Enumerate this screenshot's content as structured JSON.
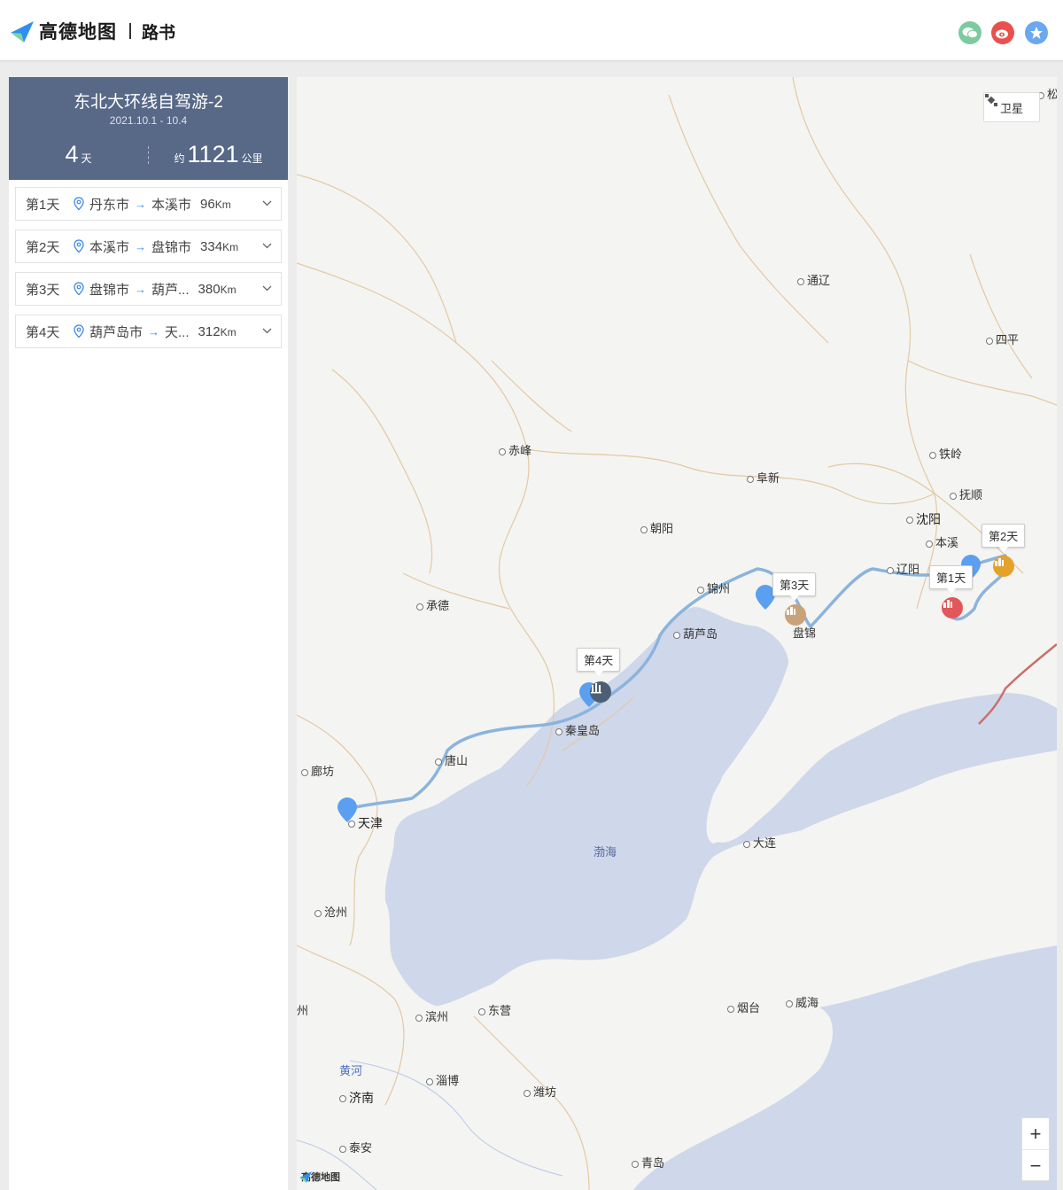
{
  "header": {
    "brand": "高德地图",
    "module": "路书",
    "share": {
      "wechat_icon": "wechat-icon",
      "weibo_icon": "weibo-icon",
      "favorite_icon": "star-icon"
    }
  },
  "trip": {
    "title": "东北大环线自驾游-2",
    "date": "2021.10.1 - 10.4",
    "days_value": "4",
    "days_unit": "天",
    "distance_prefix": "约",
    "distance_value": "1121",
    "distance_unit": "公里"
  },
  "days": [
    {
      "label": "第1天",
      "from": "丹东市",
      "to": "本溪市",
      "distance": "96",
      "unit": "Km"
    },
    {
      "label": "第2天",
      "from": "本溪市",
      "to": "盘锦市",
      "distance": "334",
      "unit": "Km"
    },
    {
      "label": "第3天",
      "from": "盘锦市",
      "to": "葫芦...",
      "distance": "380",
      "unit": "Km"
    },
    {
      "label": "第4天",
      "from": "葫芦岛市",
      "to": "天...",
      "distance": "312",
      "unit": "Km"
    }
  ],
  "map": {
    "satellite_label": "卫星",
    "zoom_in": "+",
    "zoom_out": "−",
    "logo_text": "高德地图",
    "callouts": {
      "day1": "第1天",
      "day2": "第2天",
      "day3": "第3天",
      "day4": "第4天"
    },
    "cities": {
      "songyuan": "松原",
      "tongliao": "通辽",
      "siping": "四平",
      "chifeng": "赤峰",
      "fuxin": "阜新",
      "tieling": "铁岭",
      "fushun": "抚顺",
      "shenyang": "沈阳",
      "benxi": "本溪",
      "chaoyang": "朝阳",
      "liaoyang": "辽阳",
      "jinzhou": "锦州",
      "chengde": "承德",
      "huludao": "葫芦岛",
      "panjin": "盘锦",
      "qinhuangdao": "秦皇岛",
      "tangshan": "唐山",
      "langfang": "廊坊",
      "tianjin": "天津",
      "dalian": "大连",
      "bohai": "渤海",
      "cangzhou": "沧州",
      "zhou": "州",
      "binzhou": "滨州",
      "dongying": "东营",
      "yantai": "烟台",
      "weihai": "威海",
      "huanghe": "黄河",
      "zibo": "淄博",
      "weifang": "潍坊",
      "jinan": "济南",
      "taian": "泰安",
      "qingdao": "青岛"
    }
  },
  "colors": {
    "sidebar_card": "#586887",
    "route": "#8bb4dc",
    "sea": "#cfd7ea",
    "accent": "#3b88e8"
  }
}
